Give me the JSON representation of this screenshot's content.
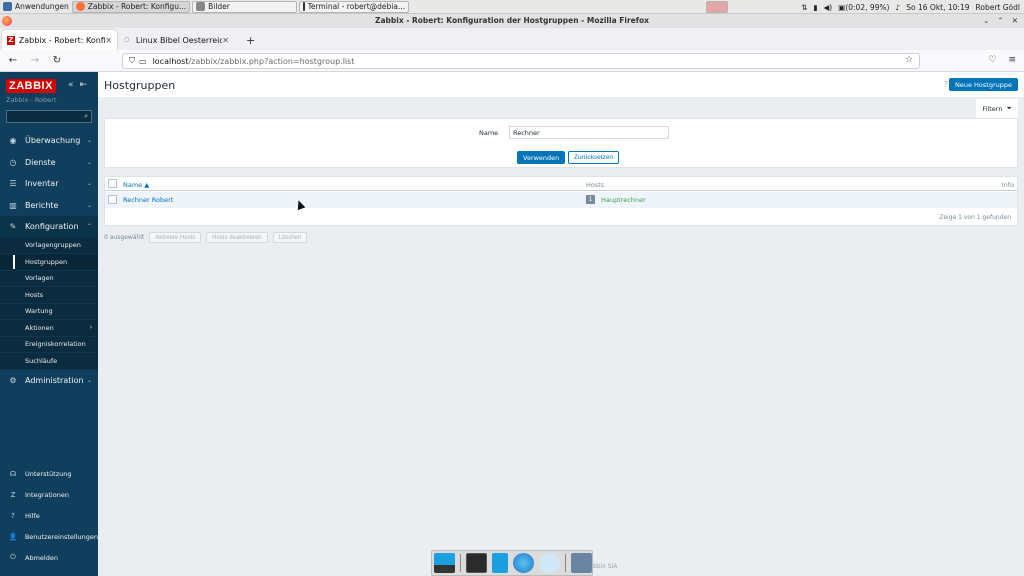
{
  "os_panel": {
    "apps_menu": "Anwendungen",
    "tasks": [
      "Zabbix - Robert: Konfigu...",
      "Bilder",
      "Terminal - robert@debia..."
    ],
    "battery": "(0:02, 99%)",
    "datetime": "So 16 Okt, 10:19",
    "user": "Robert Gödl"
  },
  "browser": {
    "window_title": "Zabbix - Robert: Konfiguration der Hostgruppen - Mozilla Firefox",
    "tabs": [
      {
        "label": "Zabbix - Robert: Konfigur"
      },
      {
        "label": "Linux Bibel Oesterreich -"
      }
    ],
    "url_host": "localhost",
    "url_path": "/zabbix/zabbix.php?action=hostgroup.list"
  },
  "sidebar": {
    "logo": "ZABBIX",
    "server_name": "Zabbix - Robert",
    "search_placeholder": "",
    "menu": [
      {
        "label": "Überwachung"
      },
      {
        "label": "Dienste"
      },
      {
        "label": "Inventar"
      },
      {
        "label": "Berichte"
      },
      {
        "label": "Konfiguration"
      }
    ],
    "submenu": [
      {
        "label": "Vorlagengruppen"
      },
      {
        "label": "Hostgruppen"
      },
      {
        "label": "Vorlagen"
      },
      {
        "label": "Hosts"
      },
      {
        "label": "Wartung"
      },
      {
        "label": "Aktionen"
      },
      {
        "label": "Ereigniskorrelation"
      },
      {
        "label": "Suchläufe"
      }
    ],
    "admin": "Administration",
    "bottom": [
      {
        "label": "Unterstützung"
      },
      {
        "label": "Integrationen"
      },
      {
        "label": "Hilfe"
      },
      {
        "label": "Benutzereinstellungen"
      },
      {
        "label": "Abmelden"
      }
    ]
  },
  "main": {
    "title": "Hostgruppen",
    "help": "?",
    "new_button": "Neue Hostgruppe",
    "filter_tab": "Filtern",
    "filter": {
      "name_label": "Name",
      "name_value": "Rechner",
      "apply": "Verwenden",
      "reset": "Zurücksetzen"
    },
    "table": {
      "headers": {
        "name": "Name ▲",
        "hosts": "Hosts",
        "info": "Info"
      },
      "rows": [
        {
          "name": "Rechner Robert",
          "host_count": "1",
          "host": "Hauptrechner"
        }
      ],
      "footer": "Zeige 1 von 1 gefunden"
    },
    "actions": {
      "selected": "0 ausgewählt",
      "enable": "Aktiviere Hosts",
      "disable": "Hosts deaktivieren",
      "delete": "Löschen"
    }
  },
  "dock": {
    "trailing_text": "bbix SIA"
  },
  "colors": {
    "sidebar": "#0f3f5c",
    "accent": "#0275b8",
    "zabbix_red": "#d40000",
    "link_green": "#429e47"
  }
}
